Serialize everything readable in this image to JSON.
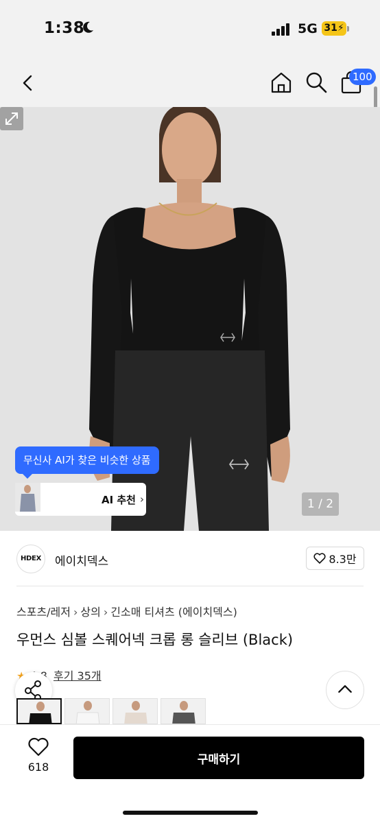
{
  "status_bar": {
    "time": "1:38",
    "network": "5G",
    "battery": "31"
  },
  "nav": {
    "cart_badge": "100"
  },
  "hero": {
    "ai_tooltip": "무신사 AI가 찾은 비슷한 상품",
    "ai_rec_label": "AI 추천",
    "image_counter": "1 / 2"
  },
  "brand": {
    "logo_text": "HDEX",
    "name": "에이치덱스",
    "likes": "8.3만"
  },
  "breadcrumb": [
    "스포츠/레저",
    "상의",
    "긴소매 티셔츠 (에이치덱스)"
  ],
  "product": {
    "title": "우먼스 심볼 스퀘어넥 크롭 롱 슬리브 (Black)",
    "rating": "4.8",
    "reviews": "후기 35개"
  },
  "bottom_bar": {
    "wish_count": "618",
    "buy_label": "구매하기"
  },
  "colors": {
    "accent_blue": "#2f6bff",
    "battery": "#f5c518",
    "buy_button": "#000000"
  }
}
